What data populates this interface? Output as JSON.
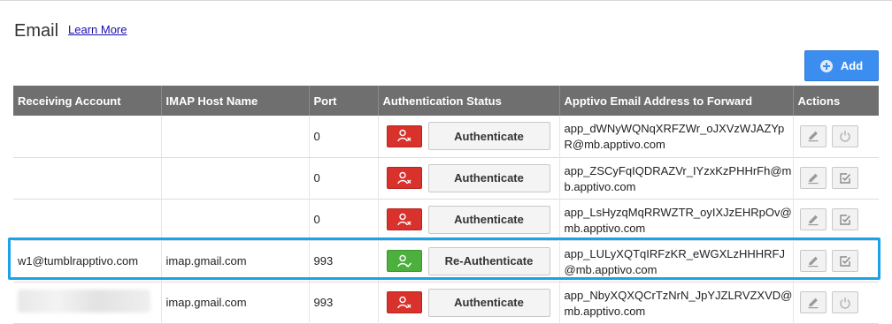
{
  "page": {
    "title": "Email",
    "learn_more": "Learn More",
    "add_label": "Add"
  },
  "table": {
    "headers": [
      "Receiving Account",
      "IMAP Host Name",
      "Port",
      "Authentication Status",
      "Apptivo Email Address to Forward",
      "Actions"
    ],
    "rows": [
      {
        "account": "",
        "host": "",
        "port": "0",
        "auth_status": "failed",
        "auth_button": "Authenticate",
        "forward": "app_dWNyWQNqXRFZWr_oJXVzWJAZYpR@mb.apptivo.com",
        "second_action": "power-icon"
      },
      {
        "account": "",
        "host": "",
        "port": "0",
        "auth_status": "failed",
        "auth_button": "Authenticate",
        "forward": "app_ZSCyFqIQDRAZVr_IYzxKzPHHrFh@mb.apptivo.com",
        "second_action": "edit-check-icon"
      },
      {
        "account": "",
        "host": "",
        "port": "0",
        "auth_status": "failed",
        "auth_button": "Authenticate",
        "forward": "app_LsHyzqMqRRWZTR_oyIXJzEHRpOv@mb.apptivo.com",
        "second_action": "edit-check-icon"
      },
      {
        "account": "w1@tumblrapptivo.com",
        "host": "imap.gmail.com",
        "port": "993",
        "auth_status": "ok",
        "auth_button": "Re-Authenticate",
        "forward": "app_LULyXQTqIRFzKR_eWGXLzHHHRFJ@mb.apptivo.com",
        "second_action": "edit-check-icon"
      },
      {
        "account": "",
        "host": "imap.gmail.com",
        "port": "993",
        "auth_status": "failed",
        "auth_button": "Authenticate",
        "forward": "app_NbyXQXQCrTzNrN_JpYJZLRVZXVD@mb.apptivo.com",
        "second_action": "power-icon"
      }
    ]
  },
  "colors": {
    "header_bg": "#6f6f6f",
    "add_button": "#3b8ef0",
    "status_failed": "#d9312b",
    "status_ok": "#4caf3e",
    "highlight": "#1aa3e8"
  }
}
